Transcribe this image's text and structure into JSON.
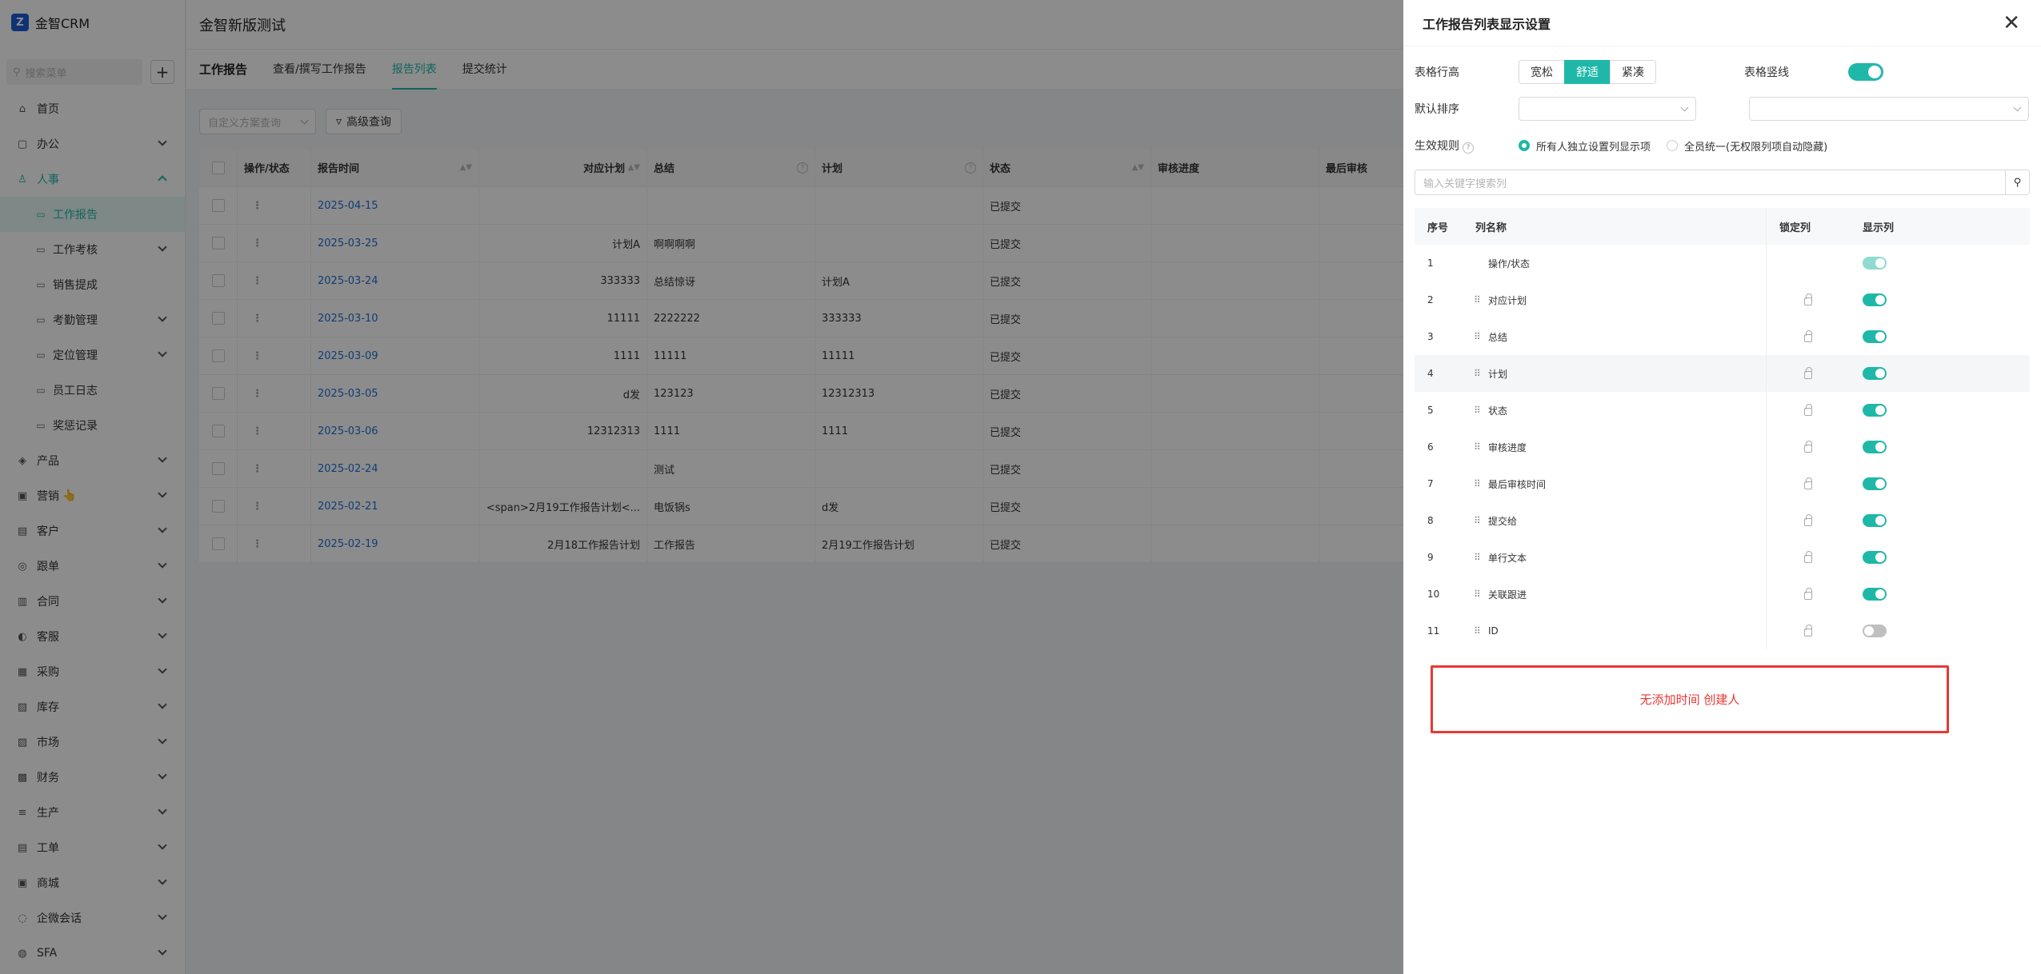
{
  "brand": {
    "name": "金智CRM",
    "logo_glyph": "Z"
  },
  "sidebar": {
    "search_placeholder": "搜索菜单",
    "items": [
      {
        "label": "首页",
        "icon": "home-icon",
        "has_chevron": false
      },
      {
        "label": "办公",
        "icon": "office-icon",
        "has_chevron": true
      },
      {
        "label": "人事",
        "icon": "hr-icon",
        "has_chevron": true,
        "open": true
      },
      {
        "label": "产品",
        "icon": "product-icon",
        "has_chevron": true
      },
      {
        "label": "营销",
        "icon": "marketing-icon",
        "has_chevron": true,
        "emoji": "👆"
      },
      {
        "label": "客户",
        "icon": "customer-icon",
        "has_chevron": true
      },
      {
        "label": "跟单",
        "icon": "follow-icon",
        "has_chevron": true
      },
      {
        "label": "合同",
        "icon": "contract-icon",
        "has_chevron": true
      },
      {
        "label": "客服",
        "icon": "service-icon",
        "has_chevron": true
      },
      {
        "label": "采购",
        "icon": "purchase-icon",
        "has_chevron": true
      },
      {
        "label": "库存",
        "icon": "stock-icon",
        "has_chevron": true
      },
      {
        "label": "市场",
        "icon": "market-icon",
        "has_chevron": true
      },
      {
        "label": "财务",
        "icon": "finance-icon",
        "has_chevron": true
      },
      {
        "label": "生产",
        "icon": "production-icon",
        "has_chevron": true
      },
      {
        "label": "工单",
        "icon": "ticket-icon",
        "has_chevron": true
      },
      {
        "label": "商城",
        "icon": "mall-icon",
        "has_chevron": true
      },
      {
        "label": "企微会话",
        "icon": "chat-icon",
        "has_chevron": true
      },
      {
        "label": "SFA",
        "icon": "sfa-icon",
        "has_chevron": true
      }
    ],
    "hr_sub_items": [
      {
        "label": "工作报告",
        "active": true,
        "has_chevron": false
      },
      {
        "label": "工作考核",
        "has_chevron": true
      },
      {
        "label": "销售提成",
        "has_chevron": false
      },
      {
        "label": "考勤管理",
        "has_chevron": true
      },
      {
        "label": "定位管理",
        "has_chevron": true
      },
      {
        "label": "员工日志",
        "has_chevron": false
      },
      {
        "label": "奖惩记录",
        "has_chevron": false
      }
    ]
  },
  "header": {
    "title": "金智新版测试"
  },
  "tabs": {
    "head": "工作报告",
    "items": [
      {
        "label": "查看/撰写工作报告",
        "active": false
      },
      {
        "label": "报告列表",
        "active": true
      },
      {
        "label": "提交统计",
        "active": false
      }
    ]
  },
  "filters": {
    "scheme_placeholder": "自定义方案查询",
    "advanced_label": "高级查询"
  },
  "table": {
    "columns": [
      "操作/状态",
      "报告时间",
      "对应计划",
      "总结",
      "计划",
      "状态",
      "审核进度",
      "最后审核"
    ],
    "rows": [
      {
        "time": "2025-04-15",
        "plan": "",
        "summary": "",
        "plan2": "",
        "status": "已提交"
      },
      {
        "time": "2025-03-25",
        "plan": "计划A",
        "summary": "啊啊啊啊",
        "plan2": "",
        "status": "已提交"
      },
      {
        "time": "2025-03-24",
        "plan": "333333",
        "summary": "总结惊讶",
        "plan2": "计划A",
        "status": "已提交"
      },
      {
        "time": "2025-03-10",
        "plan": "11111",
        "summary": "2222222",
        "plan2": "333333",
        "status": "已提交"
      },
      {
        "time": "2025-03-09",
        "plan": "1111",
        "summary": "11111",
        "plan2": "11111",
        "status": "已提交"
      },
      {
        "time": "2025-03-05",
        "plan": "d发",
        "summary": "123123",
        "plan2": "12312313",
        "status": "已提交"
      },
      {
        "time": "2025-03-06",
        "plan": "12312313",
        "summary": "1111",
        "plan2": "1111",
        "status": "已提交"
      },
      {
        "time": "2025-02-24",
        "plan": "",
        "summary": "测试",
        "plan2": "",
        "status": "已提交"
      },
      {
        "time": "2025-02-21",
        "plan": "<span>2月19工作报告计划<...",
        "summary": "电饭锅s",
        "plan2": "d发",
        "status": "已提交"
      },
      {
        "time": "2025-02-19",
        "plan": "2月18工作报告计划",
        "summary": "工作报告",
        "plan2": "2月19工作报告计划",
        "status": "已提交"
      }
    ]
  },
  "drawer": {
    "title": "工作报告列表显示设置",
    "row_height_label": "表格行高",
    "row_height_options": [
      "宽松",
      "舒适",
      "紧凑"
    ],
    "row_height_selected": "舒适",
    "vertical_lines_label": "表格竖线",
    "vertical_lines_on": true,
    "default_sort_label": "默认排序",
    "rule_label": "生效规则",
    "rule_options": [
      "所有人独立设置列显示项",
      "全员统一(无权限列项自动隐藏)"
    ],
    "rule_selected": "所有人独立设置列显示项",
    "search_placeholder": "输入关键字搜索列",
    "col_headers": [
      "序号",
      "列名称",
      "锁定列",
      "显示列"
    ],
    "columns": [
      {
        "no": "1",
        "name": "操作/状态",
        "lockable": false,
        "shown": true,
        "fixed": true
      },
      {
        "no": "2",
        "name": "对应计划",
        "lockable": true,
        "shown": true
      },
      {
        "no": "3",
        "name": "总结",
        "lockable": true,
        "shown": true
      },
      {
        "no": "4",
        "name": "计划",
        "lockable": true,
        "shown": true
      },
      {
        "no": "5",
        "name": "状态",
        "lockable": true,
        "shown": true
      },
      {
        "no": "6",
        "name": "审核进度",
        "lockable": true,
        "shown": true
      },
      {
        "no": "7",
        "name": "最后审核时间",
        "lockable": true,
        "shown": true
      },
      {
        "no": "8",
        "name": "提交给",
        "lockable": true,
        "shown": true
      },
      {
        "no": "9",
        "name": "单行文本",
        "lockable": true,
        "shown": true
      },
      {
        "no": "10",
        "name": "关联跟进",
        "lockable": true,
        "shown": true
      },
      {
        "no": "11",
        "name": "ID",
        "lockable": true,
        "shown": false
      }
    ]
  },
  "annotation": {
    "text": "无添加时间 创建人",
    "color": "#e53935"
  },
  "colors": {
    "accent": "#1fb8a8",
    "link": "#1f6fd6",
    "brand": "#1d5bd6"
  }
}
